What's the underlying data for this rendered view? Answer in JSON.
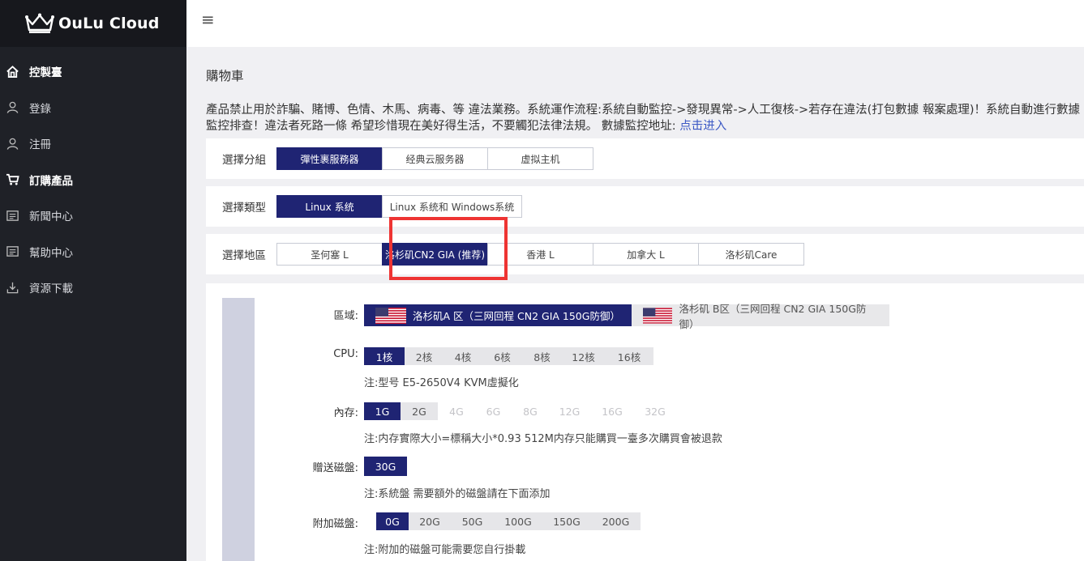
{
  "app": {
    "name": "OuLu Cloud"
  },
  "sidebar": {
    "items": [
      {
        "label": "控製臺",
        "icon": "home-icon"
      },
      {
        "label": "登錄",
        "icon": "user-icon"
      },
      {
        "label": "注冊",
        "icon": "user-icon"
      },
      {
        "label": "訂購產品",
        "icon": "cart-icon"
      },
      {
        "label": "新聞中心",
        "icon": "document-icon"
      },
      {
        "label": "幫助中心",
        "icon": "document-icon"
      },
      {
        "label": "資源下載",
        "icon": "download-icon"
      }
    ]
  },
  "topbar": {
    "menu_icon": "hamburger-icon",
    "menu_glyph": "≡"
  },
  "page": {
    "title": "購物車",
    "notice_text": "產品禁止用於詐騙、賭博、色情、木馬、病毒、等 違法業務。系統運作流程:系統自動監控->發現異常->人工復核->若存在違法(打包數據 報案處理)！系統自動進行數據監控排查！違法者死路一條 希望珍惜現在美好得生活，不要觸犯法律法規。 數據監控地址: ",
    "notice_link": "点击进入"
  },
  "group": {
    "label": "選擇分組",
    "options": [
      "彈性裹服務器",
      "经典云服务器",
      "虚拟主机"
    ],
    "selected": 0
  },
  "type": {
    "label": "選擇類型",
    "options": [
      "Linux 系统",
      "Linux 系统和 Windows系统"
    ],
    "selected": 0
  },
  "region": {
    "label": "選擇地區",
    "options": [
      "圣何塞 L",
      "洛杉矶CN2 GIA (推荐)",
      "香港 L",
      "加拿大 L",
      "洛杉矶Care"
    ],
    "selected": 1
  },
  "config": {
    "zone": {
      "label": "區域:",
      "options": [
        "洛杉矶A 区（三网回程 CN2 GIA 150G防御）",
        "洛杉矶 B区（三网回程 CN2 GIA 150G防御）"
      ],
      "selected": 0,
      "flag_icon": "us-flag-icon"
    },
    "cpu": {
      "label": "CPU:",
      "options": [
        "1核",
        "2核",
        "4核",
        "6核",
        "8核",
        "12核",
        "16核"
      ],
      "selected": 0,
      "note": "注:型号 E5-2650V4 KVM虛擬化"
    },
    "memory": {
      "label": "內存:",
      "options": [
        "1G",
        "2G",
        "4G",
        "6G",
        "8G",
        "12G",
        "16G",
        "32G"
      ],
      "selected": 0,
      "disabled_from": 2,
      "note": "注:内存實際大小=標稱大小*0.93 512M内存只能購買一臺多次購買會被退款"
    },
    "gift_disk": {
      "label": "贈送磁盤:",
      "value": "30G",
      "note": "注:系統盤 需要額外的磁盤請在下面添加"
    },
    "extra_disk": {
      "label": "附加磁盤:",
      "options": [
        "0G",
        "20G",
        "50G",
        "100G",
        "150G",
        "200G"
      ],
      "selected": 0,
      "note": "注:附加的磁盤可能需要您自行掛載"
    }
  },
  "colors": {
    "accent": "#1f2473",
    "sidebar_bg": "#1f2127",
    "highlight": "#ee3433",
    "link": "#3a57c4"
  }
}
